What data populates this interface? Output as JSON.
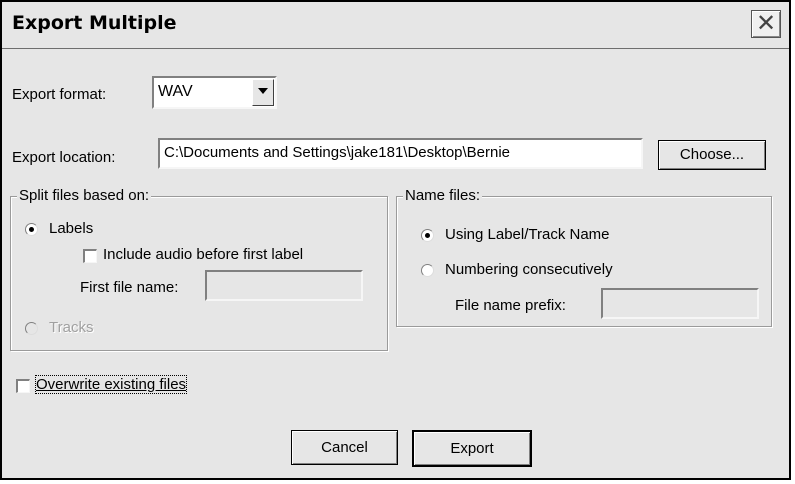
{
  "window": {
    "title": "Export Multiple",
    "close_icon": "close-icon"
  },
  "export_format": {
    "label": "Export format:",
    "value": "WAV"
  },
  "export_location": {
    "label": "Export location:",
    "value": "C:\\Documents and Settings\\jake181\\Desktop\\Bernie",
    "choose_label": "Choose..."
  },
  "split_files": {
    "legend": "Split files based on:",
    "labels_option": "Labels",
    "include_audio_label": "Include audio before first label",
    "first_file_name_label": "First file name:",
    "first_file_name_value": "",
    "tracks_option": "Tracks"
  },
  "name_files": {
    "legend": "Name files:",
    "using_label_option": "Using Label/Track Name",
    "numbering_option": "Numbering consecutively",
    "prefix_label": "File name prefix:",
    "prefix_value": ""
  },
  "overwrite_label": "Overwrite existing files",
  "buttons": {
    "cancel": "Cancel",
    "export": "Export"
  }
}
